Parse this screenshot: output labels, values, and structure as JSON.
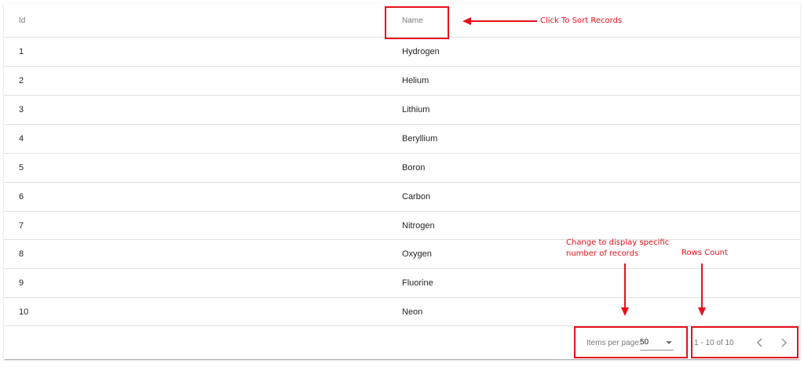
{
  "table": {
    "headers": {
      "id": "Id",
      "name": "Name"
    },
    "rows": [
      {
        "id": "1",
        "name": "Hydrogen"
      },
      {
        "id": "2",
        "name": "Helium"
      },
      {
        "id": "3",
        "name": "Lithium"
      },
      {
        "id": "4",
        "name": "Beryllium"
      },
      {
        "id": "5",
        "name": "Boron"
      },
      {
        "id": "6",
        "name": "Carbon"
      },
      {
        "id": "7",
        "name": "Nitrogen"
      },
      {
        "id": "8",
        "name": "Oxygen"
      },
      {
        "id": "9",
        "name": "Fluorine"
      },
      {
        "id": "10",
        "name": "Neon"
      }
    ]
  },
  "paginator": {
    "items_per_page_label": "Items per page:",
    "page_size": "50",
    "range_label": "1 - 10 of 10",
    "prev_icon": "chevron-left-icon",
    "next_icon": "chevron-right-icon"
  },
  "annotations": {
    "sort": "Click To Sort Records",
    "page_size_line1": "Change to display specific",
    "page_size_line2": "number of records",
    "rows_count": "Rows Count",
    "color": "#e8101b"
  }
}
